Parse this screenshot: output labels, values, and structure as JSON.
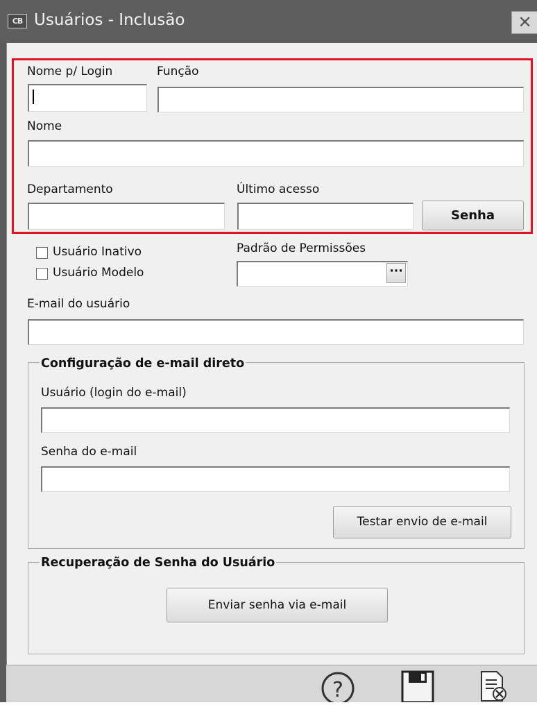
{
  "window": {
    "icon_text": "CB",
    "title": "Usuários - Inclusão",
    "close_glyph": "✕"
  },
  "form": {
    "login_label": "Nome p/ Login",
    "funcao_label": "Função",
    "nome_label": "Nome",
    "departamento_label": "Departamento",
    "ultimo_acesso_label": "Último acesso",
    "senha_button": "Senha",
    "inativo_label": "Usuário Inativo",
    "modelo_label": "Usuário Modelo",
    "permissoes_label": "Padrão de Permissões",
    "permissoes_browse": "···",
    "email_label": "E-mail do usuário"
  },
  "email_config": {
    "title": "Configuração de e-mail direto",
    "user_label": "Usuário (login do e-mail)",
    "password_label": "Senha do e-mail",
    "test_button": "Testar envio de e-mail"
  },
  "recovery": {
    "title": "Recuperação de Senha do Usuário",
    "send_button": "Enviar senha via e-mail"
  },
  "toolbar": {
    "icons": [
      "help-icon",
      "save-icon",
      "cancel-document-icon"
    ],
    "help_glyph": "?"
  },
  "colors": {
    "highlight": "#e01520",
    "titlebar": "#5e5e5e",
    "client": "#f0f0f0"
  }
}
